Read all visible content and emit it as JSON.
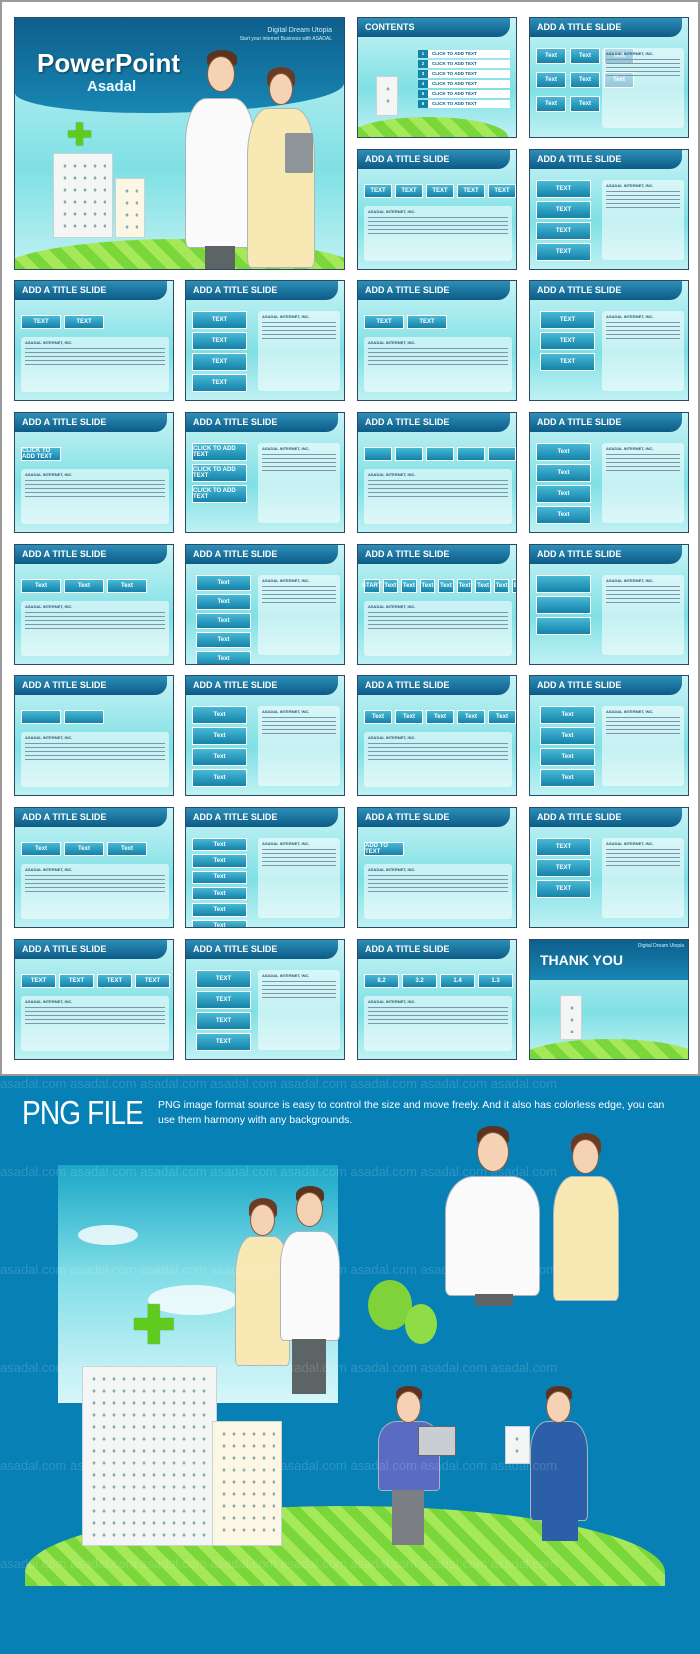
{
  "cover": {
    "title": "PowerPoint",
    "subtitle": "Asadal",
    "tagline": "Digital Dream Utopia",
    "tagline2": "Start your internet Business with ASADAL"
  },
  "contents": {
    "title": "CONTENTS",
    "items": [
      {
        "num": "1",
        "label": "CLICK TO ADD TEXT"
      },
      {
        "num": "2",
        "label": "CLICK TO ADD TEXT"
      },
      {
        "num": "3",
        "label": "CLICK TO ADD TEXT"
      },
      {
        "num": "4",
        "label": "CLICK TO ADD TEXT"
      },
      {
        "num": "5",
        "label": "CLICK TO ADD TEXT"
      },
      {
        "num": "6",
        "label": "CLICK TO ADD TEXT"
      }
    ]
  },
  "slide_title": "ADD A TITLE SLIDE",
  "body_heading": "ASADAL INTERNET, INC.",
  "slides": [
    {
      "boxes": [
        "Text",
        "Text",
        "Text",
        "Text",
        "Text",
        "Text",
        "Text",
        "Text"
      ]
    },
    {
      "boxes": [
        "TEXT",
        "TEXT",
        "TEXT",
        "TEXT",
        "TEXT"
      ]
    },
    {
      "boxes": [
        "TEXT",
        "TEXT",
        "TEXT",
        "TEXT"
      ]
    },
    {
      "boxes": [
        "TEXT",
        "TEXT"
      ]
    },
    {
      "boxes": [
        "TEXT",
        "TEXT",
        "TEXT",
        "TEXT"
      ]
    },
    {
      "boxes": [
        "TEXT",
        "TEXT"
      ]
    },
    {
      "boxes": [
        "TEXT",
        "TEXT",
        "TEXT"
      ]
    },
    {
      "boxes": [
        "CLICK TO ADD TEXT"
      ]
    },
    {
      "boxes": [
        "CLICK TO ADD TEXT",
        "CLICK TO ADD TEXT",
        "CLICK TO ADD TEXT"
      ]
    },
    {
      "boxes": [
        "",
        "",
        "",
        "",
        ""
      ]
    },
    {
      "boxes": [
        "Text",
        "Text",
        "Text",
        "Text"
      ]
    },
    {
      "boxes": [
        "Text",
        "Text",
        "Text"
      ]
    },
    {
      "boxes": [
        "Text",
        "Text",
        "Text",
        "Text",
        "Text"
      ]
    },
    {
      "boxes": [
        "START",
        "Text",
        "Text",
        "Text",
        "Text",
        "Text",
        "Text",
        "Text",
        "END"
      ]
    },
    {
      "boxes": [
        "",
        "",
        ""
      ]
    },
    {
      "boxes": [
        "",
        ""
      ]
    },
    {
      "boxes": [
        "Text",
        "Text",
        "Text",
        "Text"
      ]
    },
    {
      "boxes": [
        "Text",
        "Text",
        "Text",
        "Text",
        "Text"
      ]
    },
    {
      "boxes": [
        "Text",
        "Text",
        "Text",
        "Text"
      ]
    },
    {
      "boxes": [
        "Text",
        "Text",
        "Text"
      ]
    },
    {
      "boxes": [
        "Text",
        "Text",
        "Text",
        "Text",
        "Text",
        "Text"
      ]
    },
    {
      "boxes": [
        "ADD TO TEXT"
      ]
    },
    {
      "boxes": [
        "TEXT",
        "TEXT",
        "TEXT"
      ]
    },
    {
      "boxes": [
        "TEXT",
        "TEXT",
        "TEXT",
        "TEXT"
      ]
    },
    {
      "boxes": [
        "TEXT",
        "TEXT",
        "TEXT",
        "TEXT"
      ]
    },
    {
      "boxes": [
        "8.2",
        "3.2",
        "1.4",
        "1.3"
      ]
    }
  ],
  "thank_you": {
    "title": "THANK YOU",
    "tagline": "Digital Dream Utopia"
  },
  "png_section": {
    "title": "PNG FILE",
    "description": "PNG image format source is easy to control the size and move freely. And it also has colorless edge, you can use them harmony with any backgrounds.",
    "watermark": "asadal.com"
  },
  "colors": {
    "accent": "#0c5b86",
    "background_blue": "#0780b6",
    "green": "#5ecb1e"
  }
}
